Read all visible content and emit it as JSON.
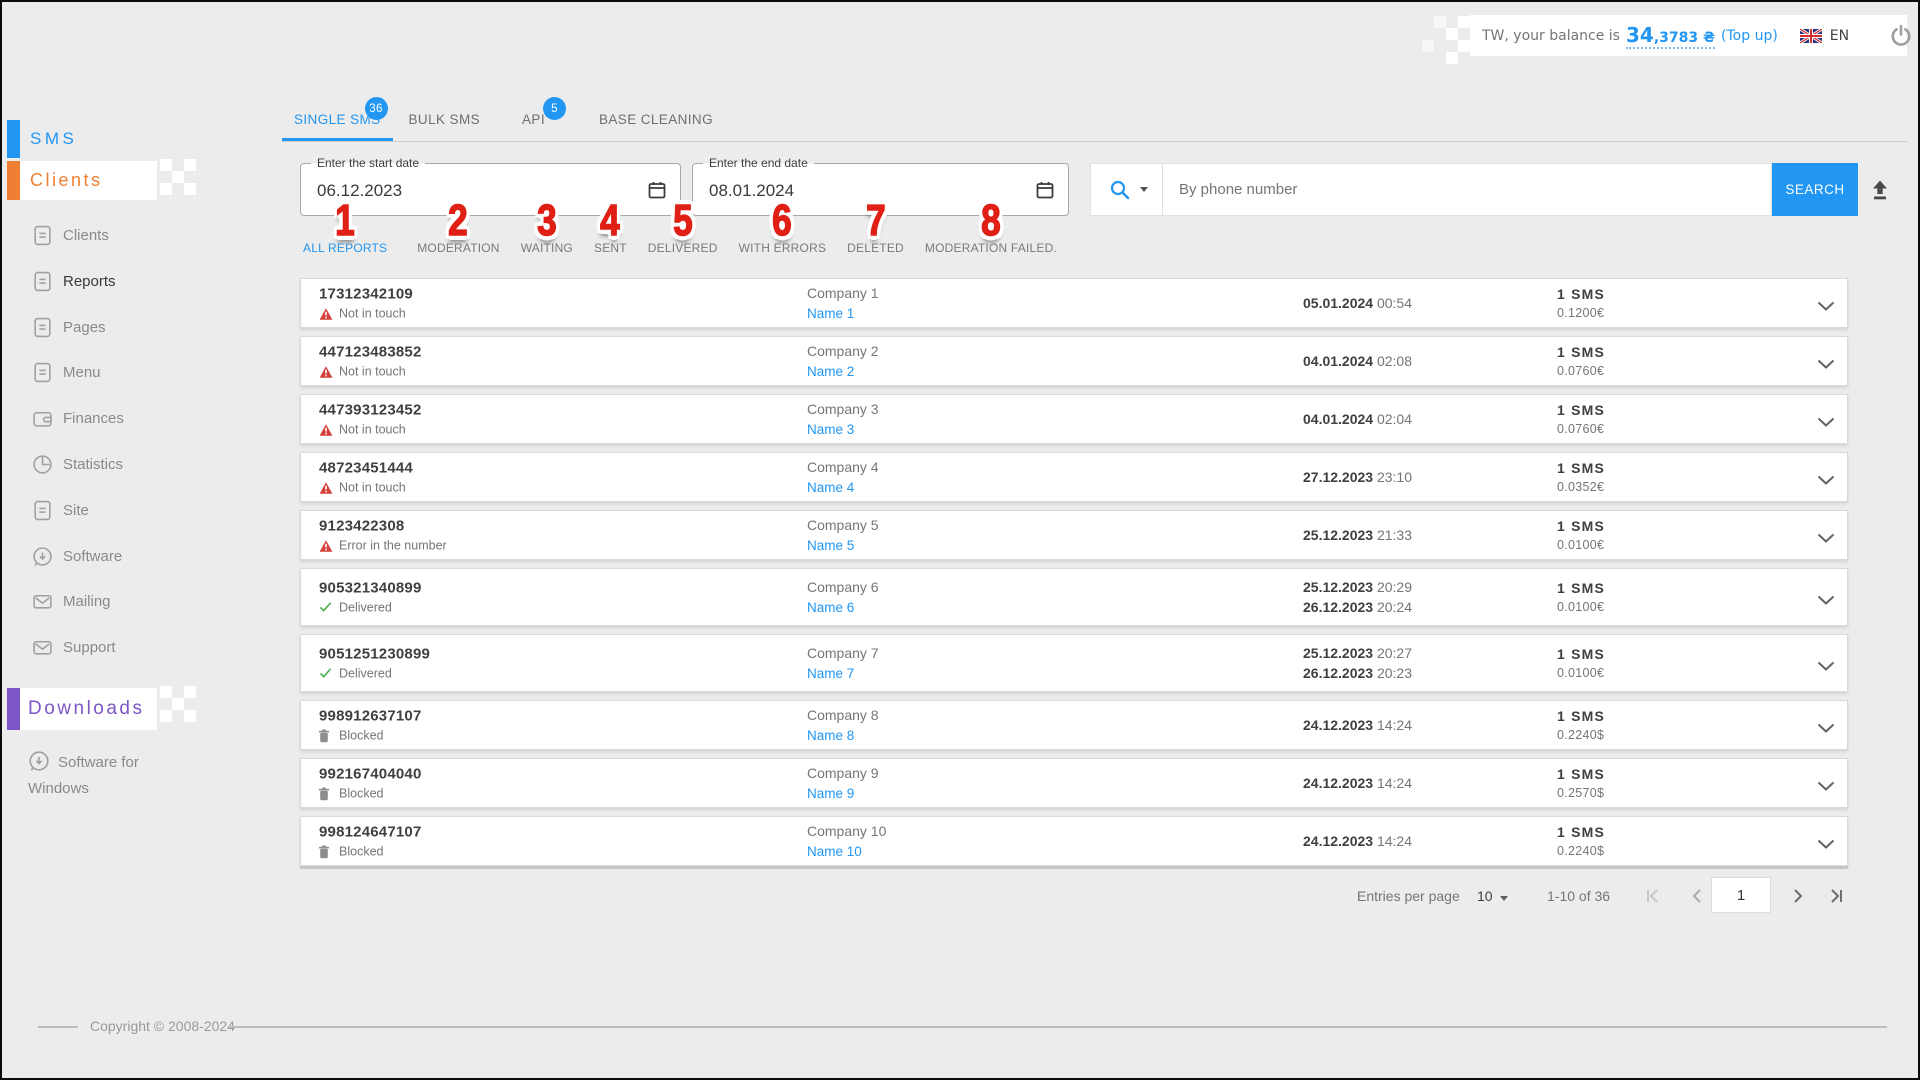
{
  "topbar": {
    "balance_prefix": "TW, your balance is",
    "balance_main": "34",
    "balance_fraction": ",3783 ₴",
    "topup": "(Top up)",
    "language": "EN"
  },
  "sidebar": {
    "sms_header": "SMS",
    "clients_header": "Clients",
    "items": [
      {
        "label": "Clients",
        "icon": "document-icon"
      },
      {
        "label": "Reports",
        "icon": "document-icon",
        "active": true
      },
      {
        "label": "Pages",
        "icon": "document-icon"
      },
      {
        "label": "Menu",
        "icon": "document-icon"
      },
      {
        "label": "Finances",
        "icon": "wallet-icon"
      },
      {
        "label": "Statistics",
        "icon": "pie-chart-icon"
      },
      {
        "label": "Site",
        "icon": "document-icon"
      },
      {
        "label": "Software",
        "icon": "download-icon"
      },
      {
        "label": "Mailing",
        "icon": "envelope-icon"
      },
      {
        "label": "Support",
        "icon": "envelope-icon"
      }
    ],
    "downloads_header": "Downloads",
    "downloads_item": "Software for Windows"
  },
  "tabs": [
    {
      "label": "SINGLE SMS",
      "badge": "36",
      "active": true
    },
    {
      "label": "BULK SMS"
    },
    {
      "label": "API",
      "badge": "5"
    },
    {
      "label": "BASE CLEANING"
    }
  ],
  "filters": {
    "start_date": {
      "label": "Enter the start date",
      "value": "06.12.2023"
    },
    "end_date": {
      "label": "Enter the end date",
      "value": "08.01.2024"
    },
    "search_placeholder": "By phone number",
    "search_button": "SEARCH"
  },
  "report_filters": [
    {
      "label": "ALL REPORTS",
      "annotation": "1",
      "active": true
    },
    {
      "label": "MODERATION",
      "annotation": "2"
    },
    {
      "label": "WAITING",
      "annotation": "3"
    },
    {
      "label": "SENT",
      "annotation": "4"
    },
    {
      "label": "DELIVERED",
      "annotation": "5"
    },
    {
      "label": "WITH ERRORS",
      "annotation": "6"
    },
    {
      "label": "DELETED",
      "annotation": "7"
    },
    {
      "label": "MODERATION FAILED.",
      "annotation": "8"
    }
  ],
  "rows": [
    {
      "phone": "17312342109",
      "status": "Not in touch",
      "status_icon": "warning-triangle-icon",
      "company": "Company 1",
      "name": "Name 1",
      "timestamps": [
        {
          "date": "05.01.2024",
          "time": "00:54"
        }
      ],
      "sms": "1 SMS",
      "price": "0.1200€"
    },
    {
      "phone": "447123483852",
      "status": "Not in touch",
      "status_icon": "warning-triangle-icon",
      "company": "Company 2",
      "name": "Name 2",
      "timestamps": [
        {
          "date": "04.01.2024",
          "time": "02:08"
        }
      ],
      "sms": "1 SMS",
      "price": "0.0760€"
    },
    {
      "phone": "447393123452",
      "status": "Not in touch",
      "status_icon": "warning-triangle-icon",
      "company": "Company 3",
      "name": "Name 3",
      "timestamps": [
        {
          "date": "04.01.2024",
          "time": "02:04"
        }
      ],
      "sms": "1 SMS",
      "price": "0.0760€"
    },
    {
      "phone": "48723451444",
      "status": "Not in touch",
      "status_icon": "warning-triangle-icon",
      "company": "Company 4",
      "name": "Name 4",
      "timestamps": [
        {
          "date": "27.12.2023",
          "time": "23:10"
        }
      ],
      "sms": "1 SMS",
      "price": "0.0352€"
    },
    {
      "phone": "9123422308",
      "status": "Error in the number",
      "status_icon": "warning-triangle-icon",
      "company": "Company 5",
      "name": "Name 5",
      "timestamps": [
        {
          "date": "25.12.2023",
          "time": "21:33"
        }
      ],
      "sms": "1 SMS",
      "price": "0.0100€"
    },
    {
      "phone": "905321340899",
      "status": "Delivered",
      "status_icon": "check-icon",
      "company": "Company 6",
      "name": "Name 6",
      "timestamps": [
        {
          "date": "25.12.2023",
          "time": "20:29"
        },
        {
          "date": "26.12.2023",
          "time": "20:24"
        }
      ],
      "sms": "1 SMS",
      "price": "0.0100€"
    },
    {
      "phone": "9051251230899",
      "status": "Delivered",
      "status_icon": "check-icon",
      "company": "Company 7",
      "name": "Name 7",
      "timestamps": [
        {
          "date": "25.12.2023",
          "time": "20:27"
        },
        {
          "date": "26.12.2023",
          "time": "20:23"
        }
      ],
      "sms": "1 SMS",
      "price": "0.0100€"
    },
    {
      "phone": "998912637107",
      "status": "Blocked",
      "status_icon": "blocked-icon",
      "company": "Company 8",
      "name": "Name 8",
      "timestamps": [
        {
          "date": "24.12.2023",
          "time": "14:24"
        }
      ],
      "sms": "1 SMS",
      "price": "0.2240$"
    },
    {
      "phone": "992167404040",
      "status": "Blocked",
      "status_icon": "blocked-icon",
      "company": "Company 9",
      "name": "Name 9",
      "timestamps": [
        {
          "date": "24.12.2023",
          "time": "14:24"
        }
      ],
      "sms": "1 SMS",
      "price": "0.2570$"
    },
    {
      "phone": "998124647107",
      "status": "Blocked",
      "status_icon": "blocked-icon",
      "company": "Company 10",
      "name": "Name 10",
      "timestamps": [
        {
          "date": "24.12.2023",
          "time": "14:24"
        }
      ],
      "sms": "1 SMS",
      "price": "0.2240$"
    }
  ],
  "pagination": {
    "entries_label": "Entries per page",
    "entries_value": "10",
    "range": "1-10 of 36",
    "page": "1"
  },
  "footer": {
    "copyright": "Copyright © 2008-2024"
  },
  "colors": {
    "accent_blue": "#2196f3",
    "sidebar_orange": "#ee7f33",
    "sidebar_purple": "#7d55c7",
    "annotation_red": "#e01f15",
    "status_error_red": "#d43f3a",
    "status_ok_green": "#4caf50"
  }
}
